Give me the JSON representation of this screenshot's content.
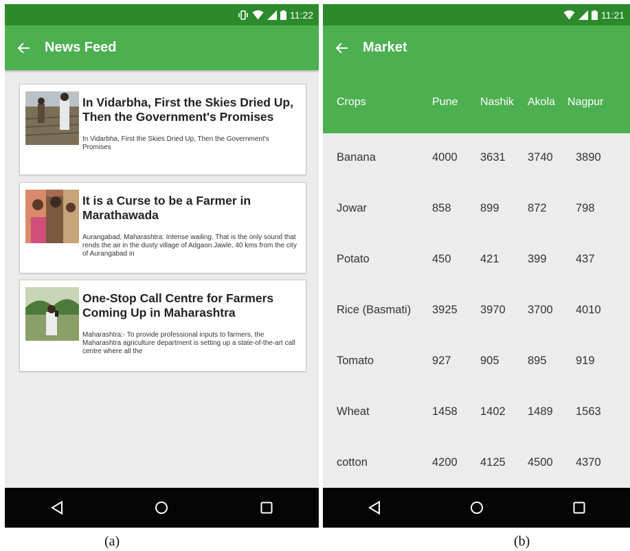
{
  "panel_a": {
    "status_time": "11:22",
    "title": "News Feed",
    "caption": "(a)",
    "cards": [
      {
        "headline": "In Vidarbha, First the Skies Dried Up, Then the Government's Promises",
        "snippet": "In Vidarbha, First the Skies Dried Up, Then the Government's Promises"
      },
      {
        "headline": "It is a Curse to be a Farmer in Marathawada",
        "snippet": "Aurangabad, Maharashtra:  Intense wailing. That is the only sound that rends the air in the dusty village of Adgaon Jawle, 40 kms from the city of Aurangabad in"
      },
      {
        "headline": "One-Stop Call Centre for Farmers Coming Up in Maharashtra",
        "snippet": "Maharashtra:- To provide professional inputs to farmers, the Maharashtra agriculture department is setting up a state-of-the-art call centre where all the"
      }
    ]
  },
  "panel_b": {
    "status_time": "11:21",
    "title": "Market",
    "caption": "(b)",
    "columns": [
      "Crops",
      "Pune",
      "Nashik",
      "Akola",
      "Nagpur"
    ],
    "rows": [
      [
        "Banana",
        "4000",
        "3631",
        "3740",
        "3890"
      ],
      [
        "Jowar",
        "858",
        "899",
        "872",
        "798"
      ],
      [
        "Potato",
        "450",
        "421",
        "399",
        "437"
      ],
      [
        "Rice (Basmati)",
        "3925",
        "3970",
        "3700",
        "4010"
      ],
      [
        "Tomato",
        "927",
        "905",
        "895",
        "919"
      ],
      [
        "Wheat",
        "1458",
        "1402",
        "1489",
        "1563"
      ],
      [
        "cotton",
        "4200",
        "4125",
        "4500",
        "4370"
      ]
    ]
  },
  "colors": {
    "status_bar": "#2d8a2c",
    "app_bar": "#4caf50",
    "background": "#ececec",
    "nav_bar": "#050505"
  },
  "icons": [
    "vibrate-icon",
    "wifi-icon",
    "signal-icon",
    "battery-icon",
    "back-arrow-icon",
    "nav-back-icon",
    "nav-home-icon",
    "nav-recents-icon"
  ]
}
